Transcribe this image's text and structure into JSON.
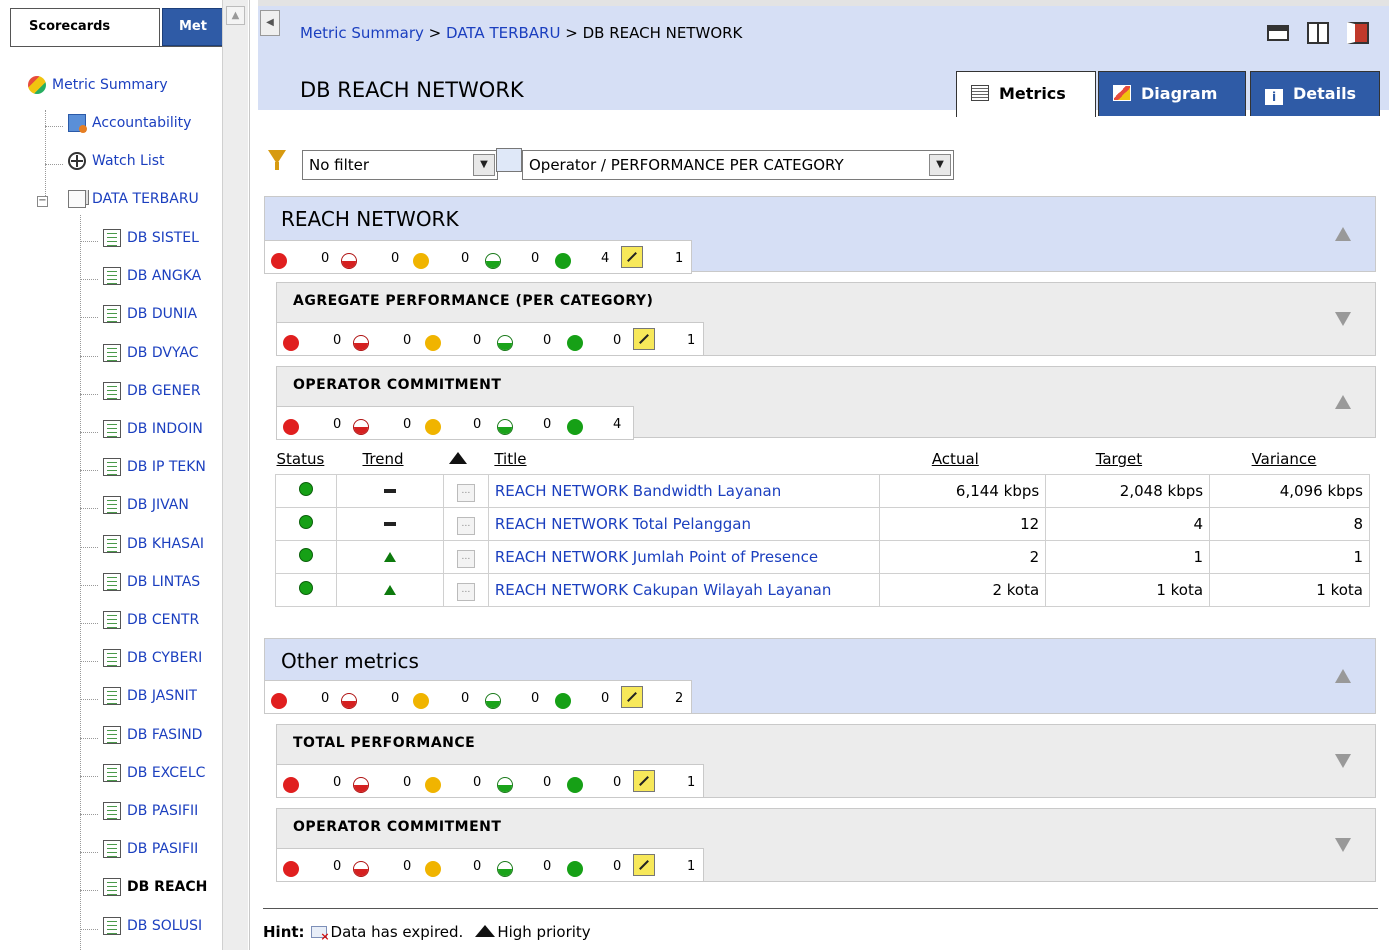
{
  "left_panel": {
    "tabs": [
      "Scorecards",
      "Met"
    ],
    "tree": [
      {
        "label": "Metric Summary",
        "icon": "summary-icon"
      },
      {
        "label": "Accountability",
        "icon": "accountability-icon"
      },
      {
        "label": "Watch List",
        "icon": "watch-list-icon"
      },
      {
        "label": "DATA TERBARU",
        "icon": "folder-icon"
      },
      {
        "label": "DB SISTEL",
        "icon": "scorecard-icon"
      },
      {
        "label": "DB ANGKA",
        "icon": "scorecard-icon"
      },
      {
        "label": "DB DUNIA",
        "icon": "scorecard-icon"
      },
      {
        "label": "DB DVYAC",
        "icon": "scorecard-icon"
      },
      {
        "label": "DB GENER",
        "icon": "scorecard-icon"
      },
      {
        "label": "DB INDOIN",
        "icon": "scorecard-icon"
      },
      {
        "label": "DB IP TEKN",
        "icon": "scorecard-icon"
      },
      {
        "label": "DB JIVAN",
        "icon": "scorecard-icon"
      },
      {
        "label": "DB KHASAI",
        "icon": "scorecard-icon"
      },
      {
        "label": "DB LINTAS",
        "icon": "scorecard-icon"
      },
      {
        "label": "DB CENTR",
        "icon": "scorecard-icon"
      },
      {
        "label": "DB CYBERI",
        "icon": "scorecard-icon"
      },
      {
        "label": "DB JASNIT",
        "icon": "scorecard-icon"
      },
      {
        "label": "DB FASIND",
        "icon": "scorecard-icon"
      },
      {
        "label": "DB EXCELC",
        "icon": "scorecard-icon"
      },
      {
        "label": "DB PASIFII",
        "icon": "scorecard-icon"
      },
      {
        "label": "DB PASIFII",
        "icon": "scorecard-icon"
      },
      {
        "label": "DB REACH",
        "icon": "scorecard-icon"
      },
      {
        "label": "DB SOLUSI",
        "icon": "scorecard-icon"
      }
    ]
  },
  "header": {
    "breadcrumb": {
      "link1": "Metric Summary",
      "link2": "DATA TERBARU",
      "current": "DB REACH NETWORK",
      "sep": ">"
    },
    "title": "DB REACH NETWORK",
    "tabs": {
      "metrics": "Metrics",
      "diagram": "Diagram",
      "details": "Details"
    }
  },
  "filters": {
    "filter_value": "No filter",
    "view_value": "Operator / PERFORMANCE PER CATEGORY"
  },
  "sections": [
    {
      "title": "REACH NETWORK",
      "counts": [
        "0",
        "0",
        "0",
        "0",
        "4",
        "1"
      ]
    },
    {
      "title": "AGREGATE PERFORMANCE (PER CATEGORY)",
      "counts": [
        "0",
        "0",
        "0",
        "0",
        "0",
        "1"
      ]
    },
    {
      "title": "OPERATOR COMMITMENT",
      "counts": [
        "0",
        "0",
        "0",
        "0",
        "4"
      ]
    },
    {
      "title": "Other metrics",
      "counts": [
        "0",
        "0",
        "0",
        "0",
        "0",
        "2"
      ]
    },
    {
      "title": "TOTAL PERFORMANCE",
      "counts": [
        "0",
        "0",
        "0",
        "0",
        "0",
        "1"
      ]
    },
    {
      "title": "OPERATOR COMMITMENT",
      "counts": [
        "0",
        "0",
        "0",
        "0",
        "0",
        "1"
      ]
    }
  ],
  "table": {
    "headers": {
      "status": "Status",
      "trend": "Trend",
      "title": "Title",
      "actual": "Actual",
      "target": "Target",
      "variance": "Variance"
    },
    "rows": [
      {
        "trend": "flat",
        "title": "REACH NETWORK Bandwidth Layanan",
        "actual": "6,144 kbps",
        "target": "2,048 kbps",
        "variance": "4,096 kbps"
      },
      {
        "trend": "flat",
        "title": "REACH NETWORK Total Pelanggan",
        "actual": "12",
        "target": "4",
        "variance": "8"
      },
      {
        "trend": "up",
        "title": "REACH NETWORK Jumlah Point of Presence",
        "actual": "2",
        "target": "1",
        "variance": "1"
      },
      {
        "trend": "up",
        "title": "REACH NETWORK Cakupan Wilayah Layanan",
        "actual": "2 kota",
        "target": "1 kota",
        "variance": "1 kota"
      }
    ]
  },
  "hint": {
    "label": "Hint:",
    "expired": "Data has expired.",
    "priority": "High priority"
  },
  "colors": {
    "header_bg": "#d6dff5",
    "tab_blue": "#2f5ba6",
    "link": "#1b3fbf",
    "status_green": "#16a016",
    "status_red": "#e01f1f",
    "status_yellow": "#f0b400"
  }
}
